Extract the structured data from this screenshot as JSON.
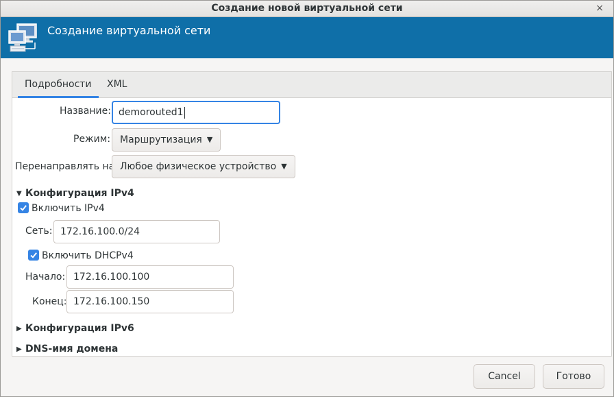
{
  "window": {
    "title": "Создание новой виртуальной сети",
    "close_glyph": "×"
  },
  "banner": {
    "heading": "Создание виртуальной сети",
    "icon": "network-computers-icon"
  },
  "tabs": [
    {
      "label": "Подробности",
      "active": true
    },
    {
      "label": "XML",
      "active": false
    }
  ],
  "form": {
    "name_label": "Название:",
    "name_value": "demorouted1",
    "mode_label": "Режим:",
    "mode_value": "Маршрутизация",
    "forward_label": "Перенаправлять на:",
    "forward_value": "Любое физическое устройство"
  },
  "ipv4": {
    "header": "Конфигурация IPv4",
    "enable_label": "Включить IPv4",
    "enable_checked": true,
    "network_label": "Сеть:",
    "network_value": "172.16.100.0/24",
    "dhcp_label": "Включить DHCPv4",
    "dhcp_checked": true,
    "start_label": "Начало:",
    "start_value": "172.16.100.100",
    "end_label": "Конец:",
    "end_value": "172.16.100.150"
  },
  "ipv6": {
    "header": "Конфигурация IPv6"
  },
  "dns": {
    "header": "DNS-имя домена"
  },
  "buttons": {
    "cancel": "Cancel",
    "finish": "Готово"
  },
  "colors": {
    "banner": "#0f6fa8",
    "accent": "#3584e4"
  }
}
